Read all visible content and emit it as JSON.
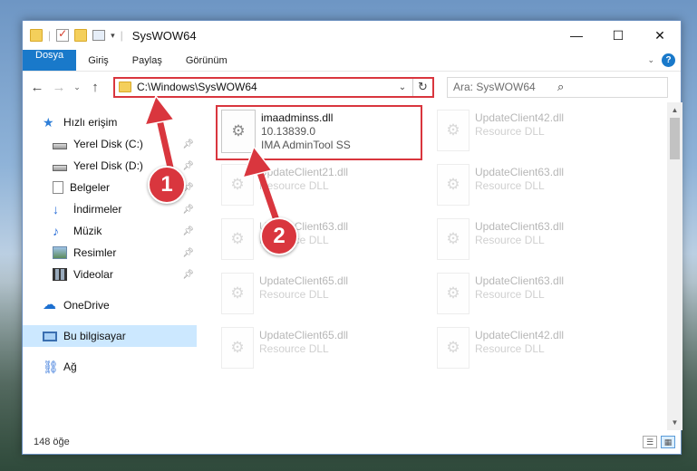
{
  "window": {
    "title": "SysWOW64",
    "controls": {
      "minimize": "—",
      "maximize": "☐",
      "close": "✕"
    }
  },
  "ribbon": {
    "tabs": [
      "Dosya",
      "Giriş",
      "Paylaş",
      "Görünüm"
    ],
    "help": "?"
  },
  "address": {
    "path": "C:\\Windows\\SysWOW64",
    "search_placeholder": "Ara: SysWOW64"
  },
  "nav": {
    "quick_access": "Hızlı erişim",
    "items": [
      {
        "label": "Yerel Disk (C:)",
        "icon": "disk-icon"
      },
      {
        "label": "Yerel Disk (D:)",
        "icon": "disk-icon"
      },
      {
        "label": "Belgeler",
        "icon": "documents-icon"
      },
      {
        "label": "İndirmeler",
        "icon": "downloads-icon"
      },
      {
        "label": "Müzik",
        "icon": "music-icon"
      },
      {
        "label": "Resimler",
        "icon": "pictures-icon"
      },
      {
        "label": "Videolar",
        "icon": "videos-icon"
      }
    ],
    "onedrive": "OneDrive",
    "this_pc": "Bu bilgisayar",
    "network": "Ağ"
  },
  "files": [
    {
      "name": "imaadminss.dll",
      "line2": "10.13839.0",
      "line3": "IMA AdminTool SS",
      "highlight": true
    },
    {
      "name": "UpdateClient42.dll",
      "line2": "Resource DLL"
    },
    {
      "name": "UpdateClient21.dll",
      "line2": "Resource DLL"
    },
    {
      "name": "UpdateClient63.dll",
      "line2": "Resource DLL"
    },
    {
      "name": "UpdateClient63.dll",
      "line2": "Resource DLL"
    },
    {
      "name": "UpdateClient63.dll",
      "line2": "Resource DLL"
    },
    {
      "name": "UpdateClient65.dll",
      "line2": "Resource DLL"
    },
    {
      "name": "UpdateClient63.dll",
      "line2": "Resource DLL"
    },
    {
      "name": "UpdateClient65.dll",
      "line2": "Resource DLL"
    },
    {
      "name": "UpdateClient42.dll",
      "line2": "Resource DLL"
    }
  ],
  "status": {
    "item_count": "148 öğe"
  },
  "annotations": {
    "marker1": "1",
    "marker2": "2",
    "color": "#d9363e"
  }
}
